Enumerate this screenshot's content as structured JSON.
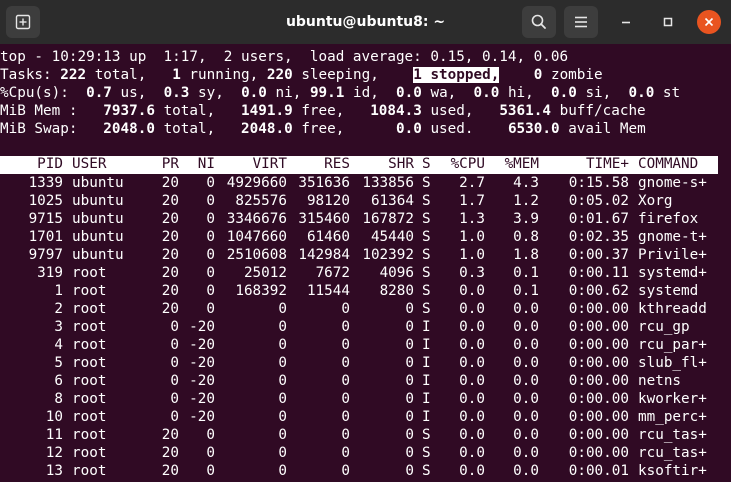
{
  "window": {
    "title": "ubuntu@ubuntu8: ~",
    "buttons": {
      "new_tab_icon": "new-tab-icon",
      "search_icon": "search-icon",
      "menu_icon": "hamburger-menu-icon",
      "minimize_icon": "minimize-icon",
      "maximize_icon": "maximize-icon",
      "close_icon": "close-icon"
    },
    "accent_color": "#e95420",
    "terminal_bg": "#300a24"
  },
  "summary": {
    "uptime": "top - 10:29:13 up  1:17,  2 users,  load average: 0.15, 0.14, 0.06",
    "tasks": {
      "label": "Tasks:",
      "total": "222",
      "total_label": "total,",
      "running": "1",
      "running_label": "running,",
      "sleeping": "220",
      "sleeping_label": "sleeping,",
      "stopped_text": "1 stopped,",
      "zombie": "0",
      "zombie_label": "zombie"
    },
    "cpu": {
      "label": "%Cpu(s):",
      "us": "0.7",
      "us_label": "us,",
      "sy": "0.3",
      "sy_label": "sy,",
      "ni": "0.0",
      "ni_label": "ni,",
      "id": "99.1",
      "id_label": "id,",
      "wa": "0.0",
      "wa_label": "wa,",
      "hi": "0.0",
      "hi_label": "hi,",
      "si": "0.0",
      "si_label": "si,",
      "st": "0.0",
      "st_label": "st"
    },
    "mem": {
      "label": "MiB Mem :",
      "total": "7937.6",
      "total_label": "total,",
      "free": "1491.9",
      "free_label": "free,",
      "used": "1084.3",
      "used_label": "used,",
      "buff": "5361.4",
      "buff_label": "buff/cache"
    },
    "swap": {
      "label": "MiB Swap:",
      "total": "2048.0",
      "total_label": "total,",
      "free": "2048.0",
      "free_label": "free,",
      "used": "0.0",
      "used_label": "used.",
      "avail": "6530.0",
      "avail_label": "avail Mem"
    }
  },
  "columns": [
    "PID",
    "USER",
    "PR",
    "NI",
    "VIRT",
    "RES",
    "SHR",
    "S",
    "%CPU",
    "%MEM",
    "TIME+",
    "COMMAND"
  ],
  "processes": [
    [
      "1339",
      "ubuntu",
      "20",
      "0",
      "4929660",
      "351636",
      "133856",
      "S",
      "2.7",
      "4.3",
      "0:15.58",
      "gnome-s+"
    ],
    [
      "1025",
      "ubuntu",
      "20",
      "0",
      "825576",
      "98120",
      "61364",
      "S",
      "1.7",
      "1.2",
      "0:05.02",
      "Xorg"
    ],
    [
      "9715",
      "ubuntu",
      "20",
      "0",
      "3346676",
      "315460",
      "167872",
      "S",
      "1.3",
      "3.9",
      "0:01.67",
      "firefox"
    ],
    [
      "1701",
      "ubuntu",
      "20",
      "0",
      "1047660",
      "61460",
      "45440",
      "S",
      "1.0",
      "0.8",
      "0:02.35",
      "gnome-t+"
    ],
    [
      "9797",
      "ubuntu",
      "20",
      "0",
      "2510608",
      "142984",
      "102392",
      "S",
      "1.0",
      "1.8",
      "0:00.37",
      "Privile+"
    ],
    [
      "319",
      "root",
      "20",
      "0",
      "25012",
      "7672",
      "4096",
      "S",
      "0.3",
      "0.1",
      "0:00.11",
      "systemd+"
    ],
    [
      "1",
      "root",
      "20",
      "0",
      "168392",
      "11544",
      "8280",
      "S",
      "0.0",
      "0.1",
      "0:00.62",
      "systemd"
    ],
    [
      "2",
      "root",
      "20",
      "0",
      "0",
      "0",
      "0",
      "S",
      "0.0",
      "0.0",
      "0:00.00",
      "kthreadd"
    ],
    [
      "3",
      "root",
      "0",
      "-20",
      "0",
      "0",
      "0",
      "I",
      "0.0",
      "0.0",
      "0:00.00",
      "rcu_gp"
    ],
    [
      "4",
      "root",
      "0",
      "-20",
      "0",
      "0",
      "0",
      "I",
      "0.0",
      "0.0",
      "0:00.00",
      "rcu_par+"
    ],
    [
      "5",
      "root",
      "0",
      "-20",
      "0",
      "0",
      "0",
      "I",
      "0.0",
      "0.0",
      "0:00.00",
      "slub_fl+"
    ],
    [
      "6",
      "root",
      "0",
      "-20",
      "0",
      "0",
      "0",
      "I",
      "0.0",
      "0.0",
      "0:00.00",
      "netns"
    ],
    [
      "8",
      "root",
      "0",
      "-20",
      "0",
      "0",
      "0",
      "I",
      "0.0",
      "0.0",
      "0:00.00",
      "kworker+"
    ],
    [
      "10",
      "root",
      "0",
      "-20",
      "0",
      "0",
      "0",
      "I",
      "0.0",
      "0.0",
      "0:00.00",
      "mm_perc+"
    ],
    [
      "11",
      "root",
      "20",
      "0",
      "0",
      "0",
      "0",
      "S",
      "0.0",
      "0.0",
      "0:00.00",
      "rcu_tas+"
    ],
    [
      "12",
      "root",
      "20",
      "0",
      "0",
      "0",
      "0",
      "S",
      "0.0",
      "0.0",
      "0:00.00",
      "rcu_tas+"
    ],
    [
      "13",
      "root",
      "20",
      "0",
      "0",
      "0",
      "0",
      "S",
      "0.0",
      "0.0",
      "0:00.01",
      "ksoftir+"
    ]
  ]
}
